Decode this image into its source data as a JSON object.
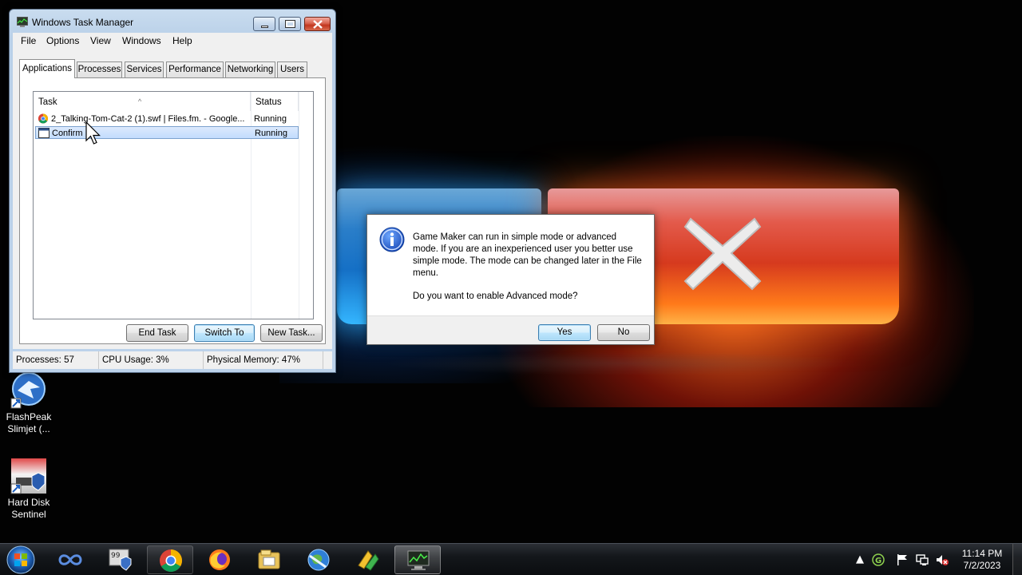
{
  "desktop": {
    "icons": [
      {
        "label_line1": "FlashPeak",
        "label_line2": "Slimjet (...",
        "icon": "slimjet-icon"
      },
      {
        "label_line1": "Hard Disk",
        "label_line2": "Sentinel",
        "icon": "hard-disk-sentinel-icon"
      }
    ]
  },
  "task_manager": {
    "title": "Windows Task Manager",
    "menu": [
      "File",
      "Options",
      "View",
      "Windows",
      "Help"
    ],
    "tabs": [
      "Applications",
      "Processes",
      "Services",
      "Performance",
      "Networking",
      "Users"
    ],
    "active_tab": "Applications",
    "columns": {
      "task": "Task",
      "status": "Status"
    },
    "rows": [
      {
        "task": "2_Talking-Tom-Cat-2 (1).swf | Files.fm. - Google...",
        "status": "Running",
        "icon": "chrome-icon"
      },
      {
        "task": "Confirm",
        "status": "Running",
        "icon": "window-icon",
        "selected": true
      }
    ],
    "buttons": {
      "end_task": "End Task",
      "switch_to": "Switch To",
      "new_task": "New Task..."
    },
    "status": {
      "processes": "Processes: 57",
      "cpu": "CPU Usage: 3%",
      "memory": "Physical Memory: 47%"
    }
  },
  "dialog": {
    "icon": "info-icon",
    "message": "Game Maker can run in simple mode or advanced mode. If you are an inexperienced user you better use simple mode.  The mode can be changed later in the File menu.",
    "question": "Do you want to enable Advanced mode?",
    "yes": "Yes",
    "no": "No"
  },
  "taskbar": {
    "pinned": [
      {
        "icon": "infinity-app-icon"
      },
      {
        "icon": "security-shield-app-icon"
      },
      {
        "icon": "chrome-icon",
        "state": "running"
      },
      {
        "icon": "firefox-icon"
      },
      {
        "icon": "file-explorer-icon"
      },
      {
        "icon": "globe-browser-icon"
      },
      {
        "icon": "game-maker-icon"
      },
      {
        "icon": "task-manager-icon",
        "state": "active"
      }
    ],
    "tray": [
      "expand-tray-icon",
      "gadget-g-icon",
      "action-center-flag-icon",
      "network-icon",
      "volume-muted-icon"
    ],
    "time": "11:14 PM",
    "date": "7/2/2023"
  }
}
